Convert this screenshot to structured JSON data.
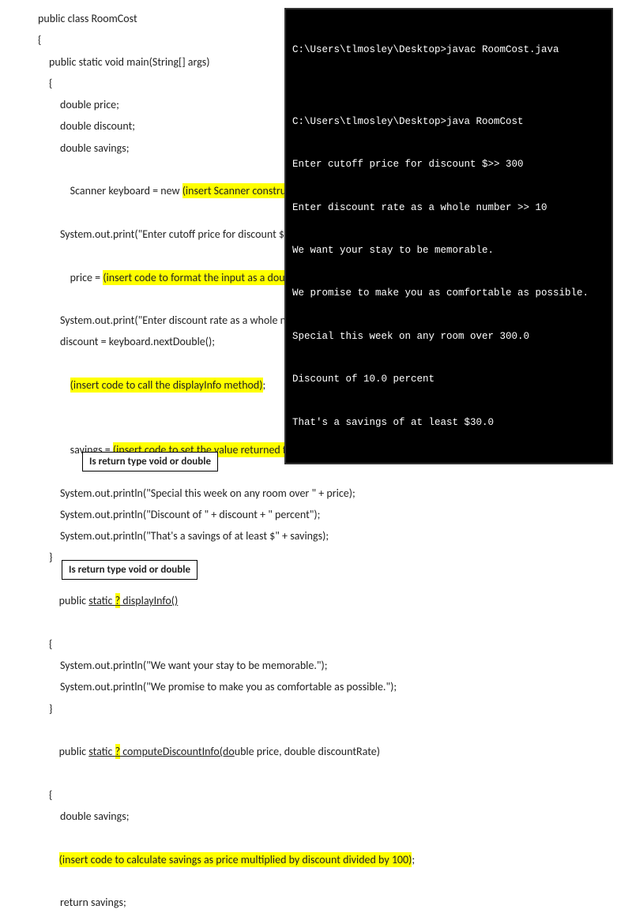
{
  "terminal": {
    "l1": "C:\\Users\\tlmosley\\Desktop>javac RoomCost.java",
    "l2": "",
    "l3": "C:\\Users\\tlmosley\\Desktop>java RoomCost",
    "l4": "Enter cutoff price for discount $>> 300",
    "l5": "Enter discount rate as a whole number >> 10",
    "l6": "We want your stay to be memorable.",
    "l7": "We promise to make you as comfortable as possible.",
    "l8": "Special this week on any room over 300.0",
    "l9": "Discount of 10.0 percent",
    "l10": "That's a savings of at least $30.0"
  },
  "code": {
    "c1": "public class RoomCost",
    "c2": "{",
    "c3": "public static void main(String[] args)",
    "c4": "{",
    "c5": "double price;",
    "c6": "double discount;",
    "c7": "double savings;",
    "c8a": "Scanner keyboard = new ",
    "c8b": "(insert Scanner constructor code)",
    "c8c": ";",
    "c9": "System.out.print(\"Enter cutoff price for discount $>> \");",
    "c10a": "price = ",
    "c10b": "(insert code to format the input as a double for the keyboard scanner object)",
    "c10c": " ;",
    "c11": "System.out.print(\"Enter discount rate as a whole number >> \");",
    "c12": "discount = keyboard.nextDouble();",
    "c13a": "(insert code to call the displayInfo method)",
    "c13b": ";",
    "c14a": "savings = ",
    "c14b": "(insert code to set the value returned from computeDiscountInfo method to savings)",
    "c14c": ";",
    "c15": "System.out.println(\"Special this week on any room over \" + price);",
    "c16": "System.out.println(\"Discount of \" + discount + \" percent\");",
    "c17": "System.out.println(\"That's a savings of at least $\" + savings);",
    "c18": "}",
    "c19a": "public ",
    "c19b": "static ",
    "c19c": "?",
    "c19d": " displayInfo()",
    "c20": "{",
    "c21": "System.out.println(\"We want your stay to be memorable.\");",
    "c22": "System.out.println(\"We promise to make you as comfortable as possible.\");",
    "c23": "}",
    "c24a": "public ",
    "c24b": "static ",
    "c24c": "?",
    "c24d": " computeDiscountInfo(do",
    "c24e": "uble price, double discountRate)",
    "c25": "{",
    "c26": "double savings;",
    "c27a": "(insert code to calculate savings as price multiplied by discount divided by 100)",
    "c27b": ";",
    "c28": "return savings;"
  },
  "notes": {
    "n1": "Is return type void or double",
    "n2": "Is return type void or double"
  }
}
